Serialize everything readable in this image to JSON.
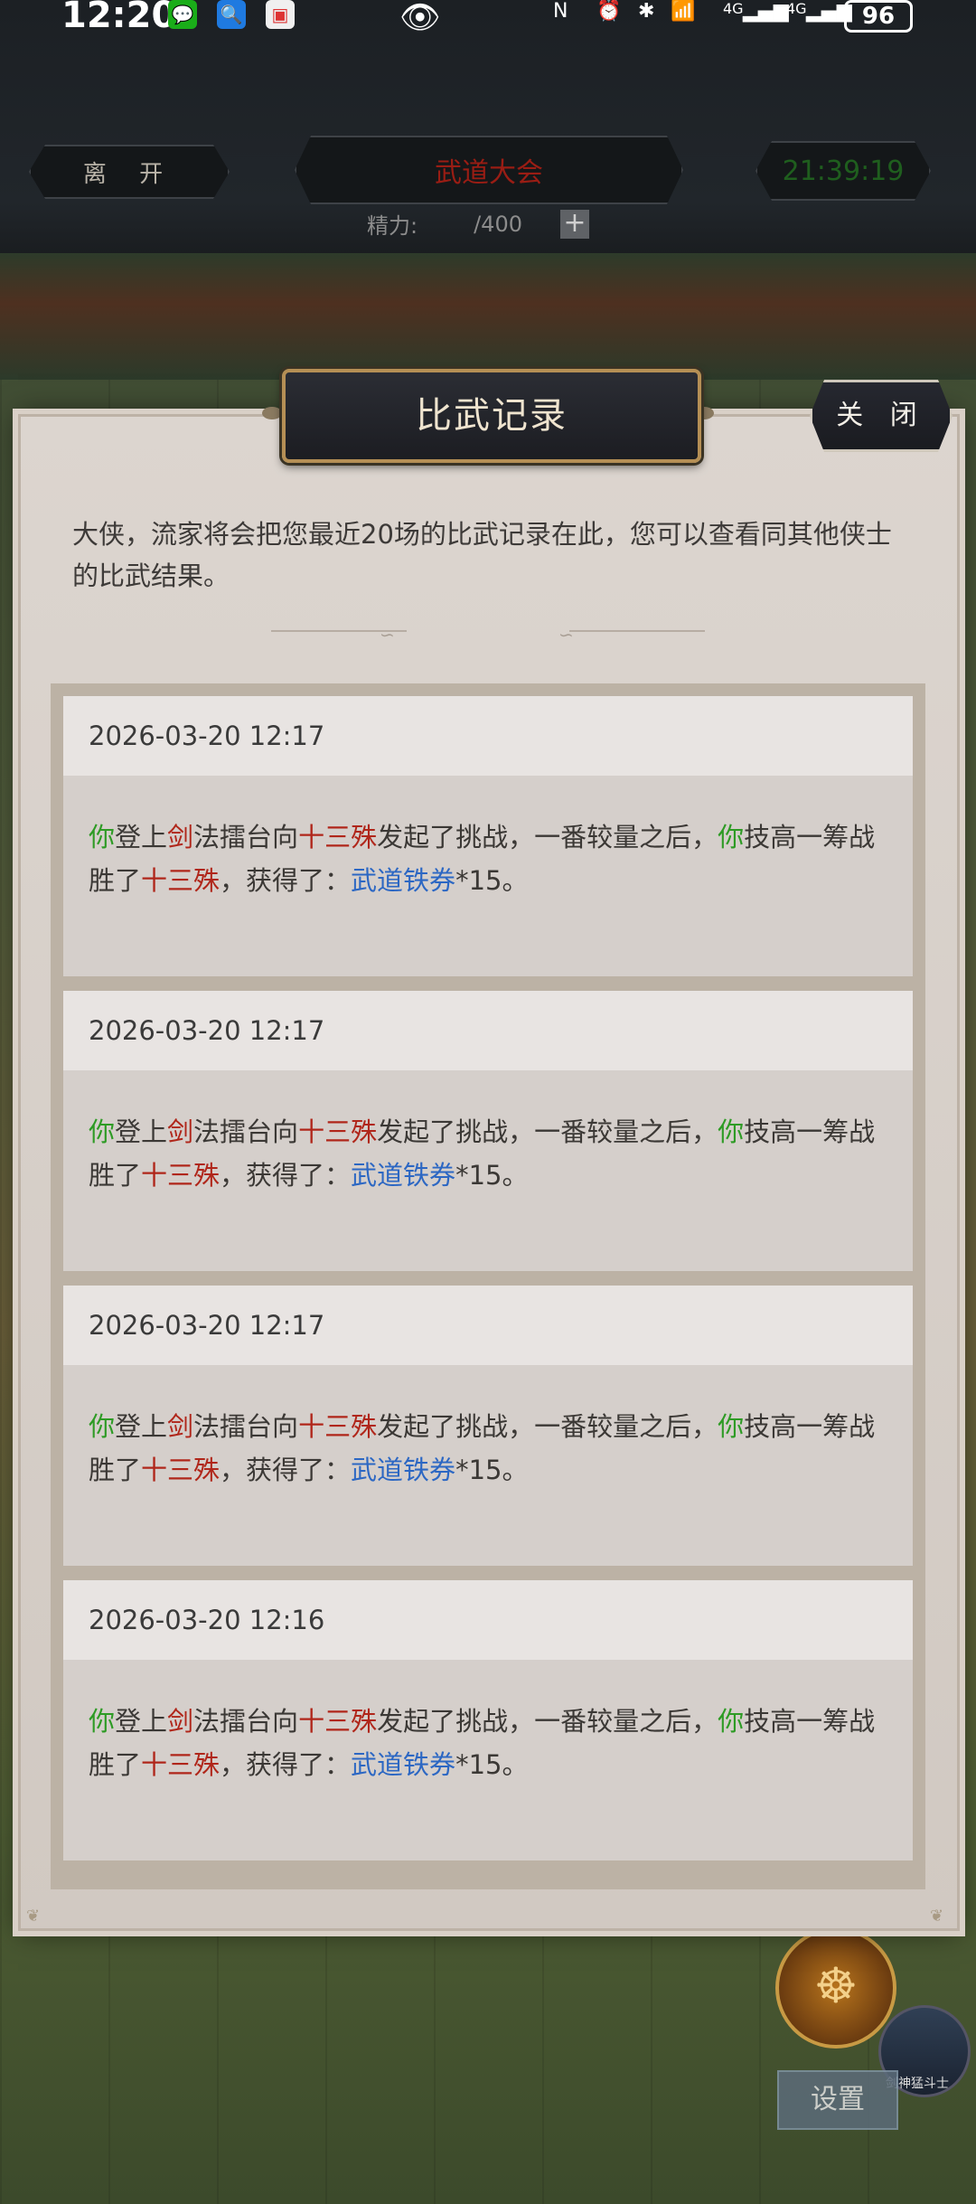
{
  "status_bar": {
    "time": "12:20",
    "apps": [
      "wechat-icon",
      "search-app-icon",
      "note-app-icon"
    ],
    "indicators": [
      "N",
      "4G",
      "4G"
    ],
    "battery": "96"
  },
  "header": {
    "leave_label": "离 开",
    "event_title": "武道大会",
    "clock": "21:39:19",
    "energy_label": "精力:",
    "energy_max": "/400",
    "plus_label": "+"
  },
  "modal": {
    "title": "比武记录",
    "close_label": "关 闭",
    "intro": "大侠，流家将会把您最近20场的比武记录在此，您可以查看同其他侠士的比武结果。"
  },
  "records": [
    {
      "timestamp": "2026-03-20 12:17",
      "actor": "你",
      "t1": "登上",
      "weapon": "剑",
      "t2": "法擂台向",
      "opponent": "十三殊",
      "t3": "发起了挑战，一番较量之后，",
      "actor2": "你",
      "t4": "技高一筹战胜了",
      "opponent2": "十三殊",
      "t5": "，获得了：",
      "reward": "武道铁券",
      "qty": "*15",
      "t6": "。"
    },
    {
      "timestamp": "2026-03-20 12:17",
      "actor": "你",
      "t1": "登上",
      "weapon": "剑",
      "t2": "法擂台向",
      "opponent": "十三殊",
      "t3": "发起了挑战，一番较量之后，",
      "actor2": "你",
      "t4": "技高一筹战胜了",
      "opponent2": "十三殊",
      "t5": "，获得了：",
      "reward": "武道铁券",
      "qty": "*15",
      "t6": "。"
    },
    {
      "timestamp": "2026-03-20 12:17",
      "actor": "你",
      "t1": "登上",
      "weapon": "剑",
      "t2": "法擂台向",
      "opponent": "十三殊",
      "t3": "发起了挑战，一番较量之后，",
      "actor2": "你",
      "t4": "技高一筹战胜了",
      "opponent2": "十三殊",
      "t5": "，获得了：",
      "reward": "武道铁券",
      "qty": "*15",
      "t6": "。"
    },
    {
      "timestamp": "2026-03-20 12:16",
      "actor": "你",
      "t1": "登上",
      "weapon": "剑",
      "t2": "法擂台向",
      "opponent": "十三殊",
      "t3": "发起了挑战，一番较量之后，",
      "actor2": "你",
      "t4": "技高一筹战胜了",
      "opponent2": "十三殊",
      "t5": "，获得了：",
      "reward": "武道铁券",
      "qty": "*15",
      "t6": "。"
    }
  ],
  "game_ui": {
    "settings_label": "设置",
    "avatar_label": "剑神猛斗士"
  },
  "colors": {
    "actor": "#2e9b25",
    "enemy": "#b0261a",
    "reward": "#2c67c3",
    "modal_bg": "#dcd5cf"
  }
}
